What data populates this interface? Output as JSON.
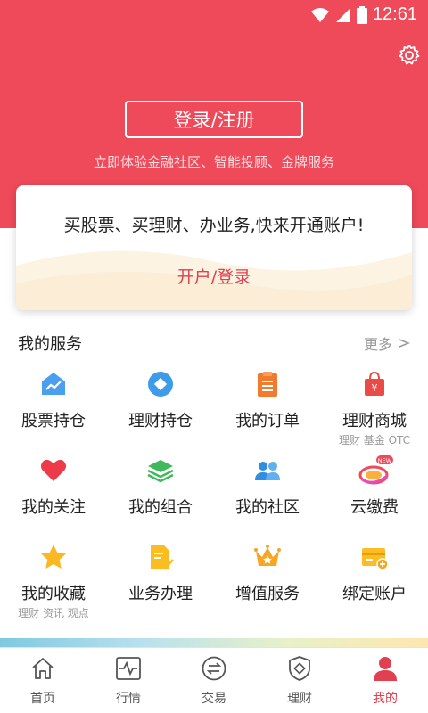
{
  "status_bar": {
    "time": "12:61"
  },
  "hero": {
    "login_button": "登录/注册",
    "subtitle": "立即体验金融社区、智能投顾、金牌服务"
  },
  "promo": {
    "title": "买股票、买理财、办业务,快来开通账户!",
    "link": "开户/登录"
  },
  "services": {
    "title": "我的服务",
    "more": "更多",
    "items": [
      {
        "label": "股票持仓",
        "sub": "",
        "icon": "stock-chart-icon"
      },
      {
        "label": "理财持仓",
        "sub": "",
        "icon": "diamond-icon"
      },
      {
        "label": "我的订单",
        "sub": "",
        "icon": "order-clipboard-icon"
      },
      {
        "label": "理财商城",
        "sub": "理财 基金 OTC",
        "icon": "shopping-bag-icon"
      },
      {
        "label": "我的关注",
        "sub": "",
        "icon": "heart-icon"
      },
      {
        "label": "我的组合",
        "sub": "",
        "icon": "layers-icon"
      },
      {
        "label": "我的社区",
        "sub": "",
        "icon": "people-icon"
      },
      {
        "label": "云缴费",
        "sub": "",
        "icon": "cloud-pay-icon",
        "badge": "NEW"
      },
      {
        "label": "我的收藏",
        "sub": "理财 资讯 观点",
        "icon": "star-icon"
      },
      {
        "label": "业务办理",
        "sub": "",
        "icon": "document-check-icon"
      },
      {
        "label": "增值服务",
        "sub": "",
        "icon": "crown-icon"
      },
      {
        "label": "绑定账户",
        "sub": "",
        "icon": "card-add-icon"
      }
    ]
  },
  "tabbar": {
    "items": [
      {
        "label": "首页",
        "icon": "home-icon"
      },
      {
        "label": "行情",
        "icon": "market-chart-icon"
      },
      {
        "label": "交易",
        "icon": "exchange-icon"
      },
      {
        "label": "理财",
        "icon": "shield-icon"
      },
      {
        "label": "我的",
        "icon": "user-icon"
      }
    ],
    "active": "我的"
  },
  "colors": {
    "brand": "#ef4a5a",
    "accent_text": "#e0404f"
  }
}
